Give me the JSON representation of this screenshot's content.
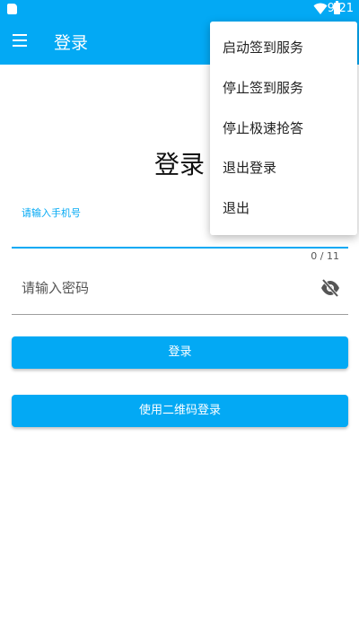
{
  "status_bar": {
    "time": "9:21"
  },
  "app_bar": {
    "title": "登录"
  },
  "page": {
    "heading": "登录"
  },
  "phone_field": {
    "label": "请输入手机号",
    "value": "",
    "counter": "0 / 11"
  },
  "password_field": {
    "placeholder": "请输入密码"
  },
  "buttons": {
    "login": "登录",
    "qr_login": "使用二维码登录"
  },
  "overflow_menu": {
    "items": [
      {
        "label": "启动签到服务"
      },
      {
        "label": "停止签到服务"
      },
      {
        "label": "停止极速抢答"
      },
      {
        "label": "退出登录"
      },
      {
        "label": "退出"
      }
    ]
  },
  "colors": {
    "primary": "#03A9F4",
    "text": "#212121"
  },
  "icons": [
    "sd-card-icon",
    "wifi-icon",
    "battery-icon",
    "menu-icon",
    "eye-off-icon"
  ]
}
